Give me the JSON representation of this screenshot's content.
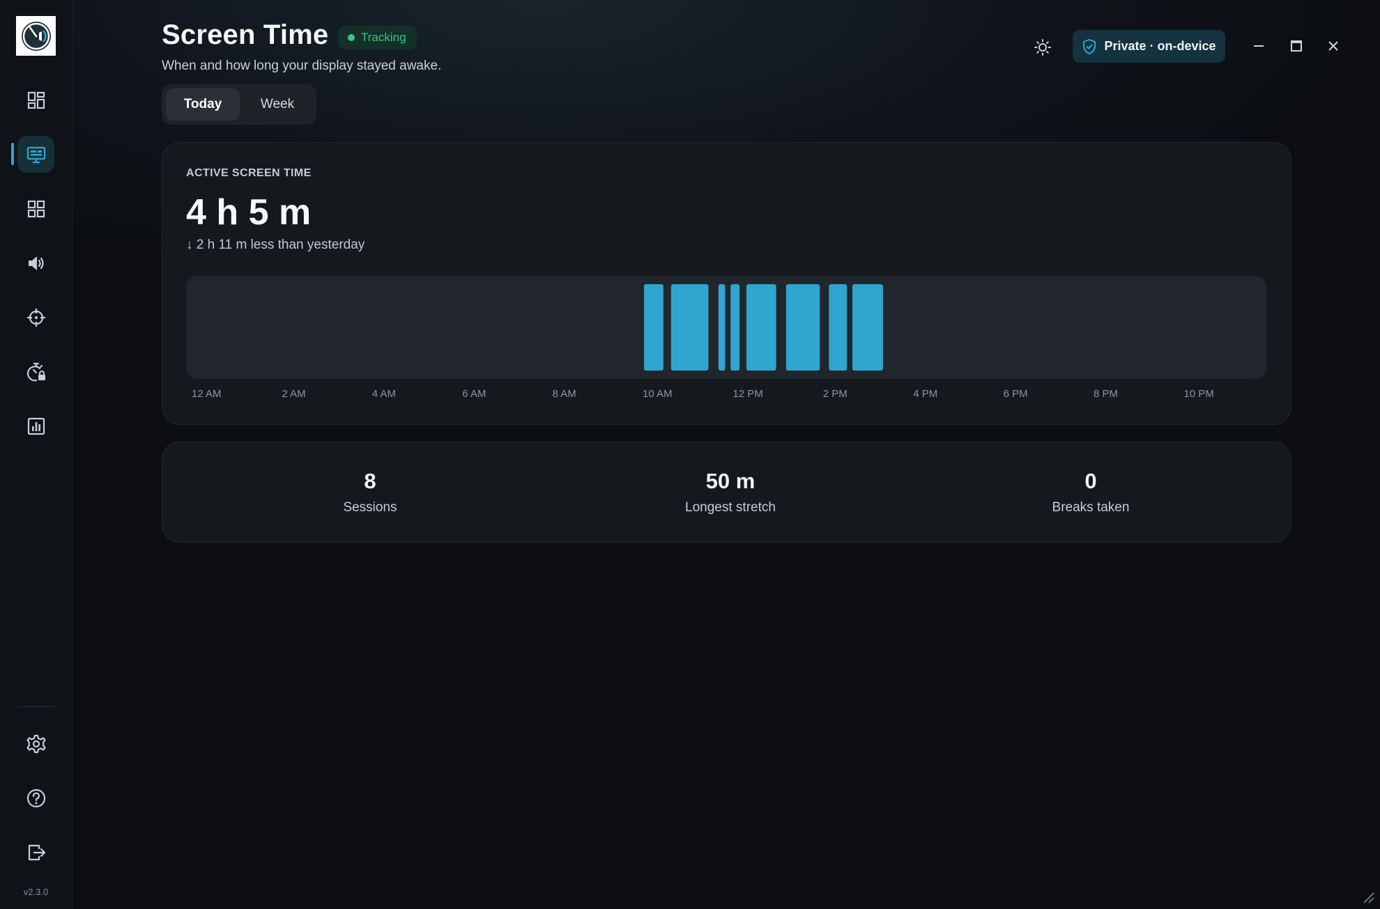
{
  "app": {
    "version": "v2.3.0",
    "title": "Screen Time",
    "subtitle": "When and how long your display stayed awake.",
    "status_badge": "Tracking",
    "privacy_label": "Private · on-device"
  },
  "sidebar": {
    "items": [
      {
        "name": "dashboard",
        "icon": "dashboard-icon",
        "active": false
      },
      {
        "name": "screen-time",
        "icon": "monitor-icon",
        "active": true
      },
      {
        "name": "apps",
        "icon": "grid-icon",
        "active": false
      },
      {
        "name": "sound",
        "icon": "speaker-icon",
        "active": false
      },
      {
        "name": "focus",
        "icon": "crosshair-icon",
        "active": false
      },
      {
        "name": "timer-lock",
        "icon": "timer-lock-icon",
        "active": false
      },
      {
        "name": "reports",
        "icon": "bar-chart-icon",
        "active": false
      }
    ],
    "bottom_items": [
      {
        "name": "settings",
        "icon": "gear-icon"
      },
      {
        "name": "help",
        "icon": "help-icon"
      },
      {
        "name": "sign-out",
        "icon": "logout-icon"
      }
    ]
  },
  "tabs": [
    {
      "label": "Today",
      "selected": true
    },
    {
      "label": "Week",
      "selected": false
    }
  ],
  "summary": {
    "section_label": "ACTIVE SCREEN TIME",
    "total": "4 h 5 m",
    "delta": "↓ 2 h 11 m less than yesterday"
  },
  "stats": [
    {
      "value": "8",
      "label": "Sessions"
    },
    {
      "value": "50 m",
      "label": "Longest stretch"
    },
    {
      "value": "0",
      "label": "Breaks taken"
    }
  ],
  "colors": {
    "accent": "#2ea6cf",
    "tracking_green": "#3cc383",
    "card_bg": "#15191e"
  },
  "chart_data": {
    "type": "bar",
    "x_range_hours": [
      0,
      24
    ],
    "tick_labels": [
      "12 AM",
      "2 AM",
      "4 AM",
      "6 AM",
      "8 AM",
      "10 AM",
      "12 PM",
      "2 PM",
      "4 PM",
      "6 PM",
      "8 PM",
      "10 PM"
    ],
    "tick_hours": [
      0,
      2,
      4,
      6,
      8,
      10,
      12,
      14,
      16,
      18,
      20,
      22
    ],
    "sessions": [
      {
        "start": 10.0,
        "end": 10.43
      },
      {
        "start": 10.6,
        "end": 11.43
      },
      {
        "start": 11.65,
        "end": 11.8
      },
      {
        "start": 11.92,
        "end": 12.12
      },
      {
        "start": 12.27,
        "end": 12.93
      },
      {
        "start": 13.15,
        "end": 13.9
      },
      {
        "start": 14.1,
        "end": 14.5
      },
      {
        "start": 14.62,
        "end": 15.3
      }
    ]
  }
}
